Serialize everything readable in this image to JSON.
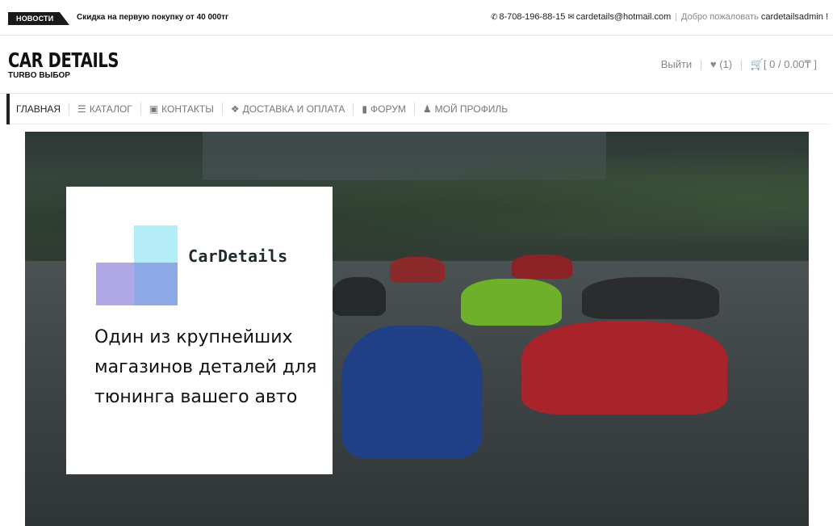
{
  "topbar": {
    "news_label": "НОВОСТИ",
    "news_text": "Скидка на первую покупку от 40 000тг",
    "phone": "8-708-196-88-15",
    "email": "cardetails@hotmail.com",
    "welcome": "Добро пожаловать",
    "username": "cardetailsadmin !",
    "phone_icon": "phone-icon",
    "email_icon": "envelope-icon"
  },
  "header": {
    "logo_title": "CAR DETAILS",
    "logo_subtitle": "TURBO ВЫБОР",
    "logout_label": "Выйти",
    "wishlist_count": "(1)",
    "cart_summary": "[ 0 / 0.00₸ ]"
  },
  "nav": {
    "items": [
      {
        "label": "ГЛАВНАЯ",
        "icon": ""
      },
      {
        "label": "КАТАЛОГ",
        "icon": "basket-icon"
      },
      {
        "label": "КОНТАКТЫ",
        "icon": "contact-card-icon"
      },
      {
        "label": "ДОСТАВКА И ОПЛАТА",
        "icon": "dropbox-icon"
      },
      {
        "label": "ФОРУМ",
        "icon": "comment-icon"
      },
      {
        "label": "МОЙ ПРОФИЛЬ",
        "icon": "user-icon"
      }
    ]
  },
  "hero": {
    "brand": "CarDetails",
    "tagline": "Один из крупнейших магазинов деталей для тюнинга вашего авто"
  },
  "colors": {
    "accent_dark": "#1a1a1a",
    "logo_square_top": "#b4ecf7",
    "logo_square_left": "#b0a8e6",
    "logo_square_mid": "#8fa8e6"
  }
}
